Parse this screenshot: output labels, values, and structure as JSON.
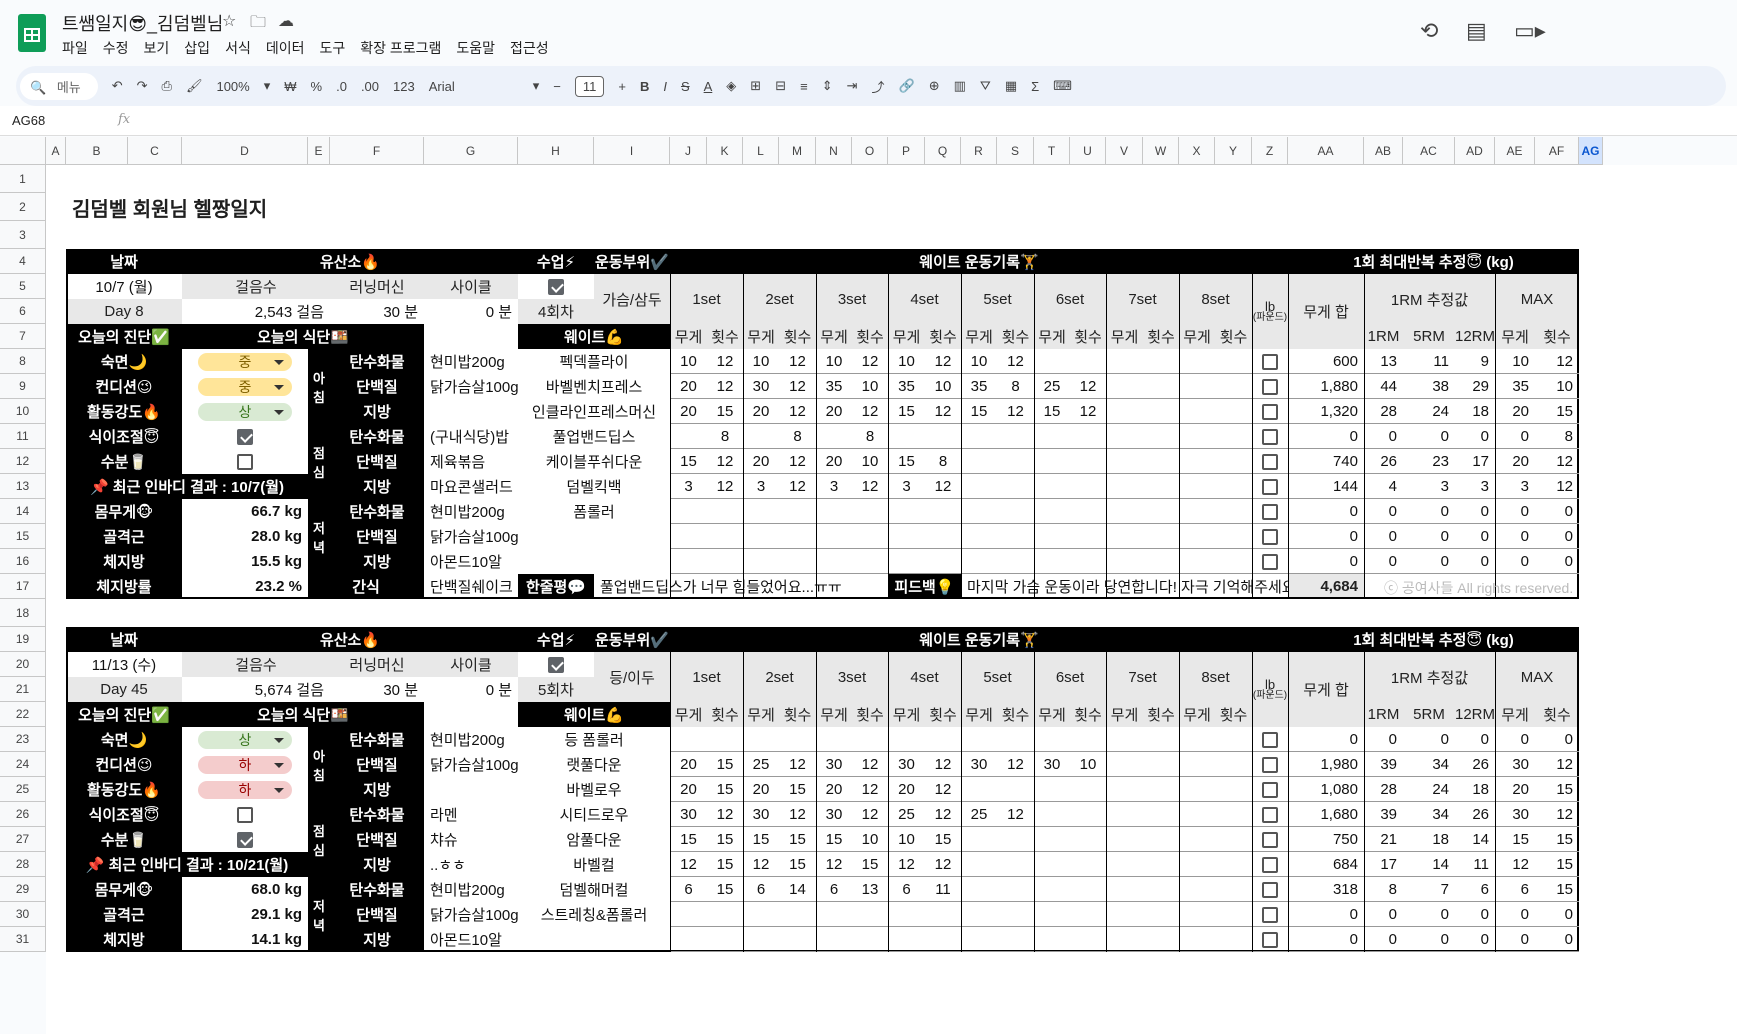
{
  "doc": {
    "title": "트쌤일지😎_김덤벨님"
  },
  "menu": [
    "파일",
    "수정",
    "보기",
    "삽입",
    "서식",
    "데이터",
    "도구",
    "확장 프로그램",
    "도움말",
    "접근성"
  ],
  "toolbar": {
    "search": "메뉴",
    "zoom": "100%",
    "currency": "₩",
    "percent": "%",
    "dec_dec": ".0",
    "dec_inc": ".00",
    "num": "123",
    "font": "Arial",
    "font_size": "11"
  },
  "namebox": "AG68",
  "fx": "fx",
  "columns": [
    "A",
    "B",
    "C",
    "D",
    "E",
    "F",
    "G",
    "H",
    "I",
    "J",
    "K",
    "L",
    "M",
    "N",
    "O",
    "P",
    "Q",
    "R",
    "S",
    "T",
    "U",
    "V",
    "W",
    "X",
    "Y",
    "Z",
    "AA",
    "AB",
    "AC",
    "AD",
    "AE",
    "AF",
    "AG"
  ],
  "rows": [
    "1",
    "2",
    "3",
    "4",
    "5",
    "6",
    "7",
    "8",
    "9",
    "10",
    "11",
    "12",
    "13",
    "14",
    "15",
    "16",
    "17",
    "18",
    "19",
    "20",
    "21",
    "22",
    "23",
    "24",
    "25",
    "26",
    "27",
    "28",
    "29",
    "30",
    "31"
  ],
  "sheet_title": "김덤벨 회원님 헬짱일지",
  "labels": {
    "date": "날짜",
    "aerobic": "유산소🔥",
    "class": "수업⚡",
    "part": "운동부위✔️",
    "weight_log": "웨이트 운동기록🏋️",
    "onerm_est": "1회 최대반복 추정😇 (kg)",
    "steps": "걸음수",
    "treadmill": "러닝머신",
    "cycle": "사이클",
    "diag": "오늘의 진단✅",
    "meal": "오늘의 식단🍱",
    "weight": "웨이트💪",
    "sets": [
      "1set",
      "2set",
      "3set",
      "4set",
      "5set",
      "6set",
      "7set",
      "8set"
    ],
    "lb": "lb",
    "lb_sub": "(파운드)",
    "sum": "무게 합",
    "rm_est": "1RM 추정값",
    "max": "MAX",
    "wt": "무게",
    "rep": "횟수",
    "rms": [
      "1RM",
      "5RM",
      "12RM"
    ],
    "sleep": "숙면🌙",
    "cond": "컨디션😉",
    "act": "활동강도🔥",
    "diet": "식이조절😇",
    "water": "수분🥛",
    "bodyw": "몸무게🐵",
    "muscle": "골격근",
    "fat": "체지방",
    "fatpct": "체지방률",
    "carb": "탄수화물",
    "prot": "단백질",
    "lipid": "지방",
    "snack": "간식",
    "oneline": "한줄평💬",
    "feedback": "피드백💡",
    "morning": [
      "아",
      "침"
    ],
    "lunch": [
      "점",
      "심"
    ],
    "dinner": [
      "저",
      "녁"
    ],
    "copyright": "ⓒ 공여사들 All rights reserved."
  },
  "log1": {
    "date": "10/7 (월)",
    "day": "Day 8",
    "steps": "2,543 걸음",
    "treadmill": "30 분",
    "cycle": "0 분",
    "class_checked": true,
    "session": "4회차",
    "part": "가슴/삼두",
    "sleep": "중",
    "cond": "중",
    "act": "상",
    "sleep_c": "mid",
    "cond_c": "mid",
    "act_c": "hi",
    "diet": true,
    "water": false,
    "inbody": "📌 최근 인바디 결과 : 10/7(월)",
    "bodyw": "66.7 kg",
    "muscle": "28.0 kg",
    "fat": "15.5 kg",
    "fatpct": "23.2 %",
    "meals": [
      "현미밥200g",
      "닭가슴살100g",
      "",
      "(구내식당)밥",
      "제육볶음",
      "마요콘샐러드",
      "현미밥200g",
      "닭가슴살100g",
      "아몬드10알"
    ],
    "snack": "단백질쉐이크",
    "oneline": "풀업밴드딥스가 너무 힘들었어요...ㅠㅠ",
    "feedback": "마지막 가슴 운동이라 당연합니다! 자극 기억해주세요",
    "total": "4,684",
    "ex": [
      {
        "n": "펙덱플라이",
        "s": [
          "10",
          "12",
          "10",
          "12",
          "10",
          "12",
          "10",
          "12",
          "10",
          "12",
          "",
          "",
          "",
          "",
          "",
          ""
        ],
        "sum": "600",
        "rm": [
          "13",
          "11",
          "9"
        ],
        "mx": [
          "10",
          "12"
        ]
      },
      {
        "n": "바벨벤치프레스",
        "s": [
          "20",
          "12",
          "30",
          "12",
          "35",
          "10",
          "35",
          "10",
          "35",
          "8",
          "25",
          "12",
          "",
          "",
          "",
          ""
        ],
        "sum": "1,880",
        "rm": [
          "44",
          "38",
          "29"
        ],
        "mx": [
          "35",
          "10"
        ]
      },
      {
        "n": "인클라인프레스머신",
        "s": [
          "20",
          "15",
          "20",
          "12",
          "20",
          "12",
          "15",
          "12",
          "15",
          "12",
          "15",
          "12",
          "",
          "",
          "",
          ""
        ],
        "sum": "1,320",
        "rm": [
          "28",
          "24",
          "18"
        ],
        "mx": [
          "20",
          "15"
        ]
      },
      {
        "n": "풀업밴드딥스",
        "s": [
          "",
          "8",
          "",
          "8",
          "",
          "8",
          "",
          "",
          "",
          "",
          "",
          "",
          "",
          "",
          "",
          ""
        ],
        "sum": "0",
        "rm": [
          "0",
          "0",
          "0"
        ],
        "mx": [
          "0",
          "8"
        ]
      },
      {
        "n": "케이블푸쉬다운",
        "s": [
          "15",
          "12",
          "20",
          "12",
          "20",
          "10",
          "15",
          "8",
          "",
          "",
          "",
          "",
          "",
          "",
          "",
          ""
        ],
        "sum": "740",
        "rm": [
          "26",
          "23",
          "17"
        ],
        "mx": [
          "20",
          "12"
        ]
      },
      {
        "n": "덤벨킥백",
        "s": [
          "3",
          "12",
          "3",
          "12",
          "3",
          "12",
          "3",
          "12",
          "",
          "",
          "",
          "",
          "",
          "",
          "",
          ""
        ],
        "sum": "144",
        "rm": [
          "4",
          "3",
          "3"
        ],
        "mx": [
          "3",
          "12"
        ]
      },
      {
        "n": "폼롤러",
        "s": [
          "",
          "",
          "",
          "",
          "",
          "",
          "",
          "",
          "",
          "",
          "",
          "",
          "",
          "",
          "",
          ""
        ],
        "sum": "0",
        "rm": [
          "0",
          "0",
          "0"
        ],
        "mx": [
          "0",
          "0"
        ]
      },
      {
        "n": "",
        "s": [
          "",
          "",
          "",
          "",
          "",
          "",
          "",
          "",
          "",
          "",
          "",
          "",
          "",
          "",
          "",
          ""
        ],
        "sum": "0",
        "rm": [
          "0",
          "0",
          "0"
        ],
        "mx": [
          "0",
          "0"
        ]
      },
      {
        "n": "",
        "s": [
          "",
          "",
          "",
          "",
          "",
          "",
          "",
          "",
          "",
          "",
          "",
          "",
          "",
          "",
          "",
          ""
        ],
        "sum": "0",
        "rm": [
          "0",
          "0",
          "0"
        ],
        "mx": [
          "0",
          "0"
        ]
      }
    ]
  },
  "log2": {
    "date": "11/13 (수)",
    "day": "Day 45",
    "steps": "5,674 걸음",
    "treadmill": "30 분",
    "cycle": "0 분",
    "class_checked": true,
    "session": "5회차",
    "part": "등/이두",
    "sleep": "상",
    "cond": "하",
    "act": "하",
    "sleep_c": "hi",
    "cond_c": "lo",
    "act_c": "lo",
    "diet": false,
    "water": true,
    "inbody": "📌 최근 인바디 결과 : 10/21(월)",
    "bodyw": "68.0 kg",
    "muscle": "29.1 kg",
    "fat": "14.1 kg",
    "meals": [
      "현미밥200g",
      "닭가슴살100g",
      "",
      "라멘",
      "챠슈",
      "..ㅎㅎ",
      "현미밥200g",
      "닭가슴살100g",
      "아몬드10알"
    ],
    "ex": [
      {
        "n": "등 폼롤러",
        "s": [
          "",
          "",
          "",
          "",
          "",
          "",
          "",
          "",
          "",
          "",
          "",
          "",
          "",
          "",
          "",
          ""
        ],
        "sum": "0",
        "rm": [
          "0",
          "0",
          "0"
        ],
        "mx": [
          "0",
          "0"
        ]
      },
      {
        "n": "랫풀다운",
        "s": [
          "20",
          "15",
          "25",
          "12",
          "30",
          "12",
          "30",
          "12",
          "30",
          "12",
          "30",
          "10",
          "",
          "",
          "",
          ""
        ],
        "sum": "1,980",
        "rm": [
          "39",
          "34",
          "26"
        ],
        "mx": [
          "30",
          "12"
        ]
      },
      {
        "n": "바벨로우",
        "s": [
          "20",
          "15",
          "20",
          "15",
          "20",
          "12",
          "20",
          "12",
          "",
          "",
          "",
          "",
          "",
          "",
          "",
          ""
        ],
        "sum": "1,080",
        "rm": [
          "28",
          "24",
          "18"
        ],
        "mx": [
          "20",
          "15"
        ]
      },
      {
        "n": "시티드로우",
        "s": [
          "30",
          "12",
          "30",
          "12",
          "30",
          "12",
          "25",
          "12",
          "25",
          "12",
          "",
          "",
          "",
          "",
          "",
          ""
        ],
        "sum": "1,680",
        "rm": [
          "39",
          "34",
          "26"
        ],
        "mx": [
          "30",
          "12"
        ]
      },
      {
        "n": "암풀다운",
        "s": [
          "15",
          "15",
          "15",
          "15",
          "15",
          "10",
          "10",
          "15",
          "",
          "",
          "",
          "",
          "",
          "",
          "",
          ""
        ],
        "sum": "750",
        "rm": [
          "21",
          "18",
          "14"
        ],
        "mx": [
          "15",
          "15"
        ]
      },
      {
        "n": "바벨컬",
        "s": [
          "12",
          "15",
          "12",
          "15",
          "12",
          "15",
          "12",
          "12",
          "",
          "",
          "",
          "",
          "",
          "",
          "",
          ""
        ],
        "sum": "684",
        "rm": [
          "17",
          "14",
          "11"
        ],
        "mx": [
          "12",
          "15"
        ]
      },
      {
        "n": "덤벨해머컬",
        "s": [
          "6",
          "15",
          "6",
          "14",
          "6",
          "13",
          "6",
          "11",
          "",
          "",
          "",
          "",
          "",
          "",
          "",
          ""
        ],
        "sum": "318",
        "rm": [
          "8",
          "7",
          "6"
        ],
        "mx": [
          "6",
          "15"
        ]
      },
      {
        "n": "스트레칭&폼롤러",
        "s": [
          "",
          "",
          "",
          "",
          "",
          "",
          "",
          "",
          "",
          "",
          "",
          "",
          "",
          "",
          "",
          ""
        ],
        "sum": "0",
        "rm": [
          "0",
          "0",
          "0"
        ],
        "mx": [
          "0",
          "0"
        ]
      },
      {
        "n": "",
        "s": [
          "",
          "",
          "",
          "",
          "",
          "",
          "",
          "",
          "",
          "",
          "",
          "",
          "",
          "",
          "",
          ""
        ],
        "sum": "0",
        "rm": [
          "0",
          "0",
          "0"
        ],
        "mx": [
          "0",
          "0"
        ]
      }
    ]
  }
}
